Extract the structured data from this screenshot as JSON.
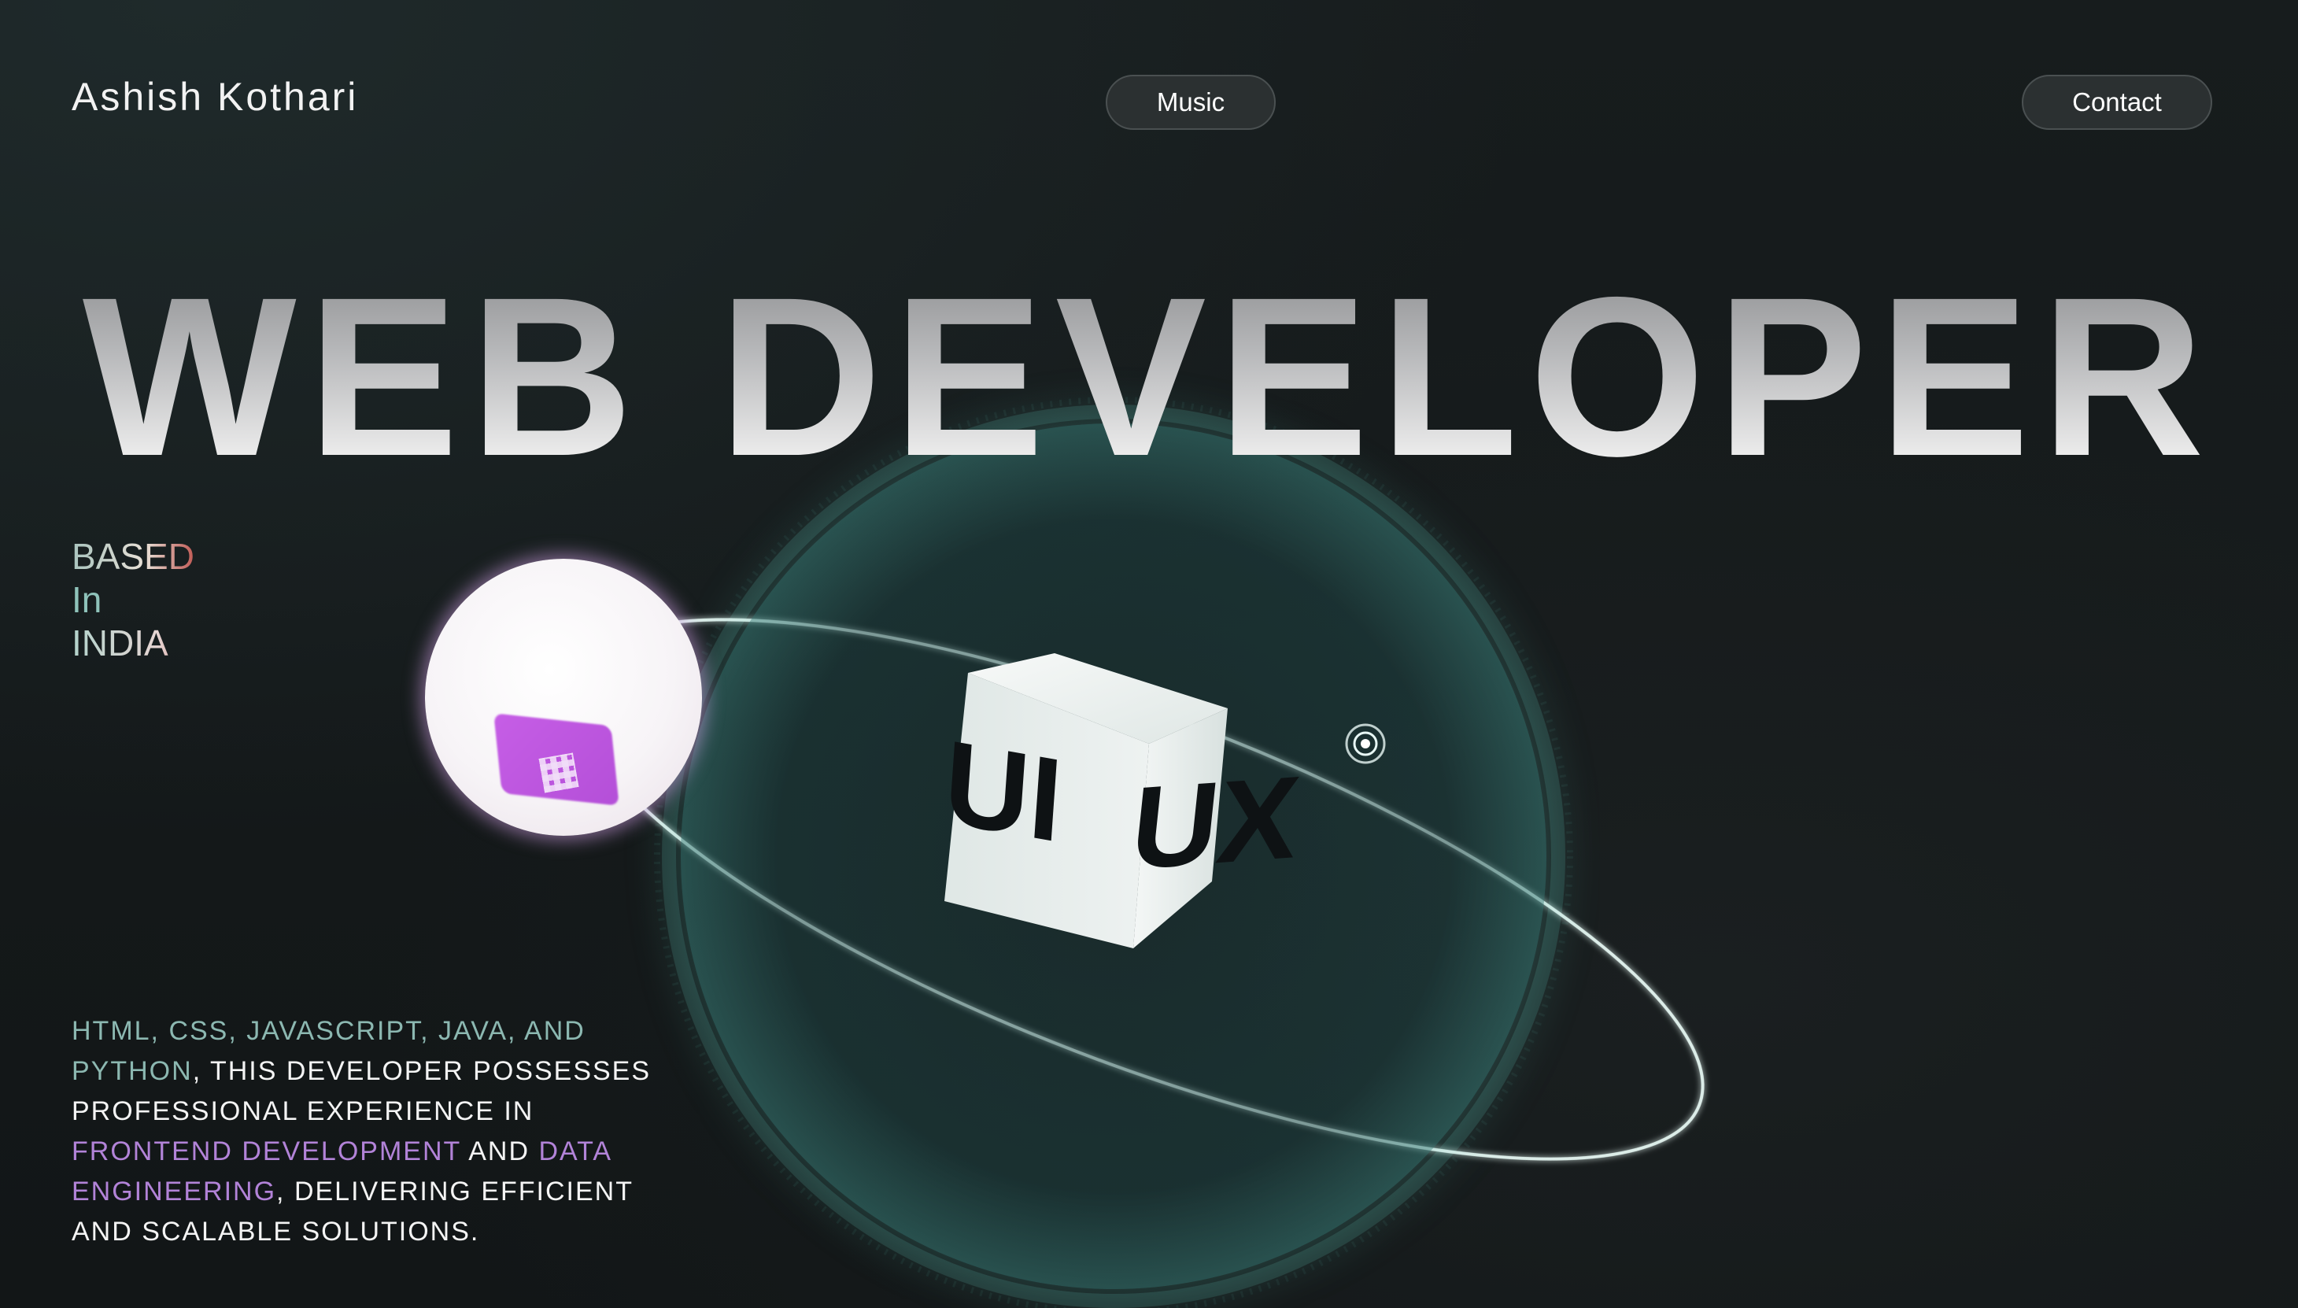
{
  "header": {
    "brand": "Ashish Kothari",
    "nav": [
      {
        "label": "Music"
      },
      {
        "label": "Contact"
      }
    ]
  },
  "hero": {
    "headline": "WEB DEVELOPER",
    "location": [
      "BASED",
      "In",
      "INDIA"
    ],
    "cube_labels": [
      "UI",
      "UX"
    ]
  },
  "blurb": {
    "part1": "HTML, CSS, JAVASCRIPT, JAVA, AND PYTHON",
    "part2": ", THIS DEVELOPER POSSESSES PROFESSIONAL EXPERIENCE IN ",
    "part3": "FRONTEND DEVELOPMENT",
    "part4": " AND ",
    "part5": "DATA ENGINEERING",
    "part6": ", DELIVERING EFFICIENT AND SCALABLE SOLUTIONS."
  },
  "colors": {
    "background": "#151a1b",
    "sphere_accent": "#6fd6c6",
    "highlight_teal": "#8cb8b1",
    "highlight_purple": "#b283d8",
    "flag": "#c65ee6"
  },
  "icons": {
    "flag": "flag-icon",
    "cube": "ui-ux-cube-icon",
    "satellite": "satellite-icon"
  }
}
